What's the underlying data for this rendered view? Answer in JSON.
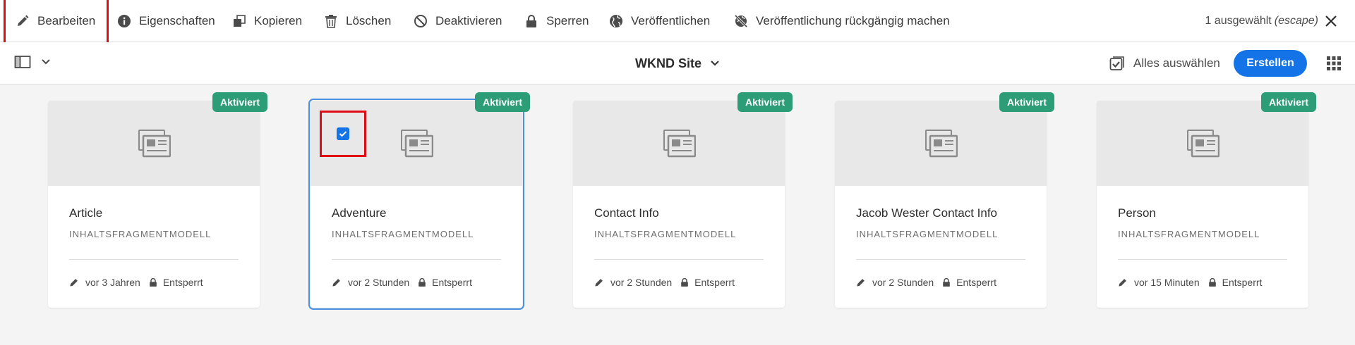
{
  "actionbar": {
    "actions": [
      {
        "label": "Bearbeiten",
        "icon": "pencil-icon"
      },
      {
        "label": "Eigenschaften",
        "icon": "info-icon"
      },
      {
        "label": "Kopieren",
        "icon": "copy-icon"
      },
      {
        "label": "Löschen",
        "icon": "trash-icon"
      },
      {
        "label": "Deaktivieren",
        "icon": "deactivate-icon"
      },
      {
        "label": "Sperren",
        "icon": "lock-icon"
      },
      {
        "label": "Veröffentlichen",
        "icon": "globe-icon"
      },
      {
        "label": "Veröffentlichung rückgängig machen",
        "icon": "globe-strike-icon"
      }
    ],
    "selection_count": "1 ausgewählt",
    "selection_hint": "(escape)"
  },
  "titlebar": {
    "site_title": "WKND Site",
    "select_all": "Alles auswählen",
    "create": "Erstellen"
  },
  "cards": [
    {
      "title": "Article",
      "type": "INHALTSFRAGMENTMODELL",
      "status": "Aktiviert",
      "modified": "vor 3 Jahren",
      "lock_status": "Entsperrt",
      "selected": false
    },
    {
      "title": "Adventure",
      "type": "INHALTSFRAGMENTMODELL",
      "status": "Aktiviert",
      "modified": "vor 2 Stunden",
      "lock_status": "Entsperrt",
      "selected": true
    },
    {
      "title": "Contact Info",
      "type": "INHALTSFRAGMENTMODELL",
      "status": "Aktiviert",
      "modified": "vor 2 Stunden",
      "lock_status": "Entsperrt",
      "selected": false
    },
    {
      "title": "Jacob Wester Contact Info",
      "type": "INHALTSFRAGMENTMODELL",
      "status": "Aktiviert",
      "modified": "vor 2 Stunden",
      "lock_status": "Entsperrt",
      "selected": false
    },
    {
      "title": "Person",
      "type": "INHALTSFRAGMENTMODELL",
      "status": "Aktiviert",
      "modified": "vor 15 Minuten",
      "lock_status": "Entsperrt",
      "selected": false
    }
  ],
  "colors": {
    "accent": "#1473e6",
    "badge": "#2d9d78",
    "highlight": "#e00a14",
    "selected_outline": "#4a90e2"
  }
}
